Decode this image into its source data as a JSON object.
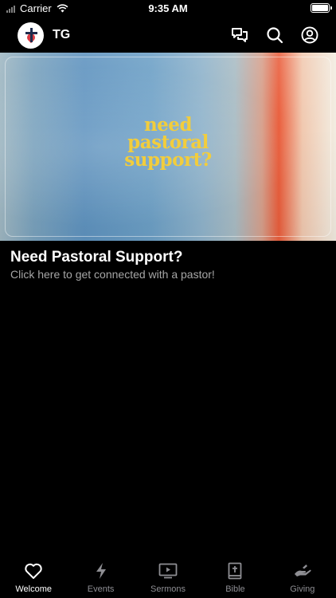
{
  "status_bar": {
    "carrier": "Carrier",
    "time": "9:35 AM",
    "battery_level": 1.0
  },
  "header": {
    "org_name": "TG",
    "icons": [
      "chat-icon",
      "search-icon",
      "profile-icon"
    ]
  },
  "banner": {
    "line1": "need",
    "line2": "pastoral",
    "line3": "support?",
    "text_color": "#f2cd3c"
  },
  "post": {
    "title": "Need Pastoral Support?",
    "subtitle": "Click here to get connected with a pastor!"
  },
  "tabs": [
    {
      "label": "Welcome",
      "icon": "heart-icon",
      "active": true
    },
    {
      "label": "Events",
      "icon": "lightning-icon",
      "active": false
    },
    {
      "label": "Sermons",
      "icon": "play-screen-icon",
      "active": false
    },
    {
      "label": "Bible",
      "icon": "bible-icon",
      "active": false
    },
    {
      "label": "Giving",
      "icon": "giving-hand-icon",
      "active": false
    }
  ],
  "colors": {
    "background": "#000000",
    "inactive_tab": "#8e8e93",
    "subtitle": "#a6a6a6"
  }
}
